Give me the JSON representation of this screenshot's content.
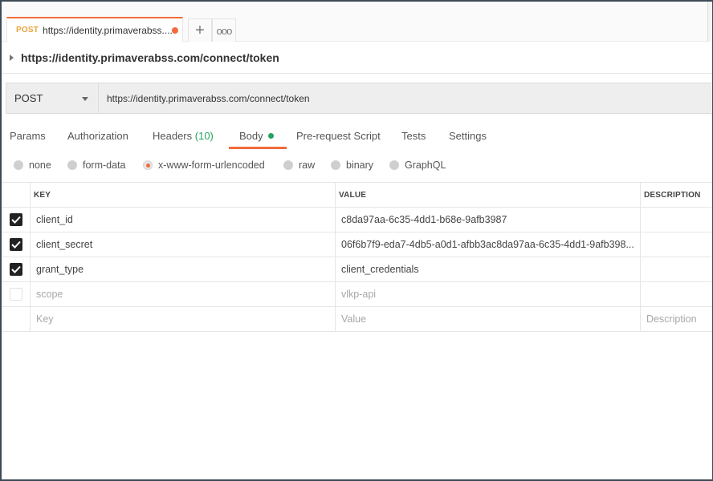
{
  "tabs": {
    "active": {
      "method": "POST",
      "title": "https://identity.primaverabss....",
      "unsaved": true
    },
    "new_tab": "+",
    "more": "ooo"
  },
  "request": {
    "name": "https://identity.primaverabss.com/connect/token",
    "method": "POST",
    "url": "https://identity.primaverabss.com/connect/token"
  },
  "request_tabs": {
    "params": "Params",
    "authorization": "Authorization",
    "headers": "Headers",
    "headers_count": "(10)",
    "body": "Body",
    "pre_request": "Pre-request Script",
    "tests": "Tests",
    "settings": "Settings",
    "active": "Body"
  },
  "body_types": {
    "none": "none",
    "form_data": "form-data",
    "urlencoded": "x-www-form-urlencoded",
    "raw": "raw",
    "binary": "binary",
    "graphql": "GraphQL",
    "selected": "x-www-form-urlencoded"
  },
  "table": {
    "headers": {
      "key": "KEY",
      "value": "VALUE",
      "description": "DESCRIPTION"
    },
    "rows": [
      {
        "checked": true,
        "key": "client_id",
        "value": "c8da97aa-6c35-4dd1-b68e-9afb3987",
        "description": ""
      },
      {
        "checked": true,
        "key": "client_secret",
        "value": "06f6b7f9-eda7-4db5-a0d1-afbb3ac8da97aa-6c35-4dd1-9afb398...",
        "description": ""
      },
      {
        "checked": true,
        "key": "grant_type",
        "value": "client_credentials",
        "description": ""
      },
      {
        "checked": false,
        "key": "scope",
        "value": "vlkp-api",
        "description": ""
      }
    ],
    "placeholder": {
      "key": "Key",
      "value": "Value",
      "description": "Description"
    }
  },
  "colors": {
    "accent": "#f26b3a",
    "method_post": "#e8a33a",
    "success_green": "#23a35f"
  }
}
